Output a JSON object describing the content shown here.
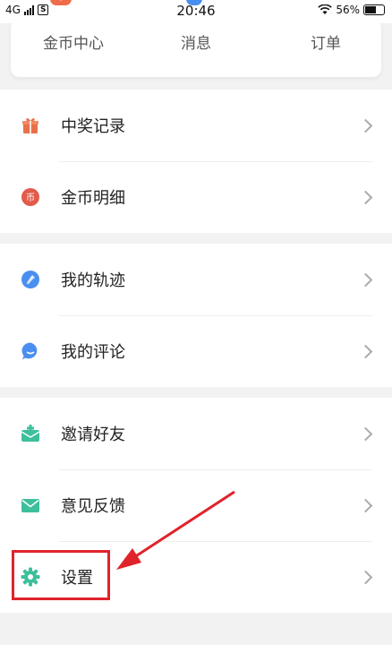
{
  "status_bar": {
    "network": "4G",
    "sim": "S",
    "time": "20:46",
    "battery": "56%"
  },
  "card": {
    "tabs": [
      "金币中心",
      "消息",
      "订单"
    ]
  },
  "sections": [
    {
      "items": [
        {
          "label": "中奖记录",
          "icon": "gift-icon"
        },
        {
          "label": "金币明细",
          "icon": "coin-icon"
        }
      ]
    },
    {
      "items": [
        {
          "label": "我的轨迹",
          "icon": "compass-icon"
        },
        {
          "label": "我的评论",
          "icon": "comment-icon"
        }
      ]
    },
    {
      "items": [
        {
          "label": "邀请好友",
          "icon": "invite-mail-icon"
        },
        {
          "label": "意见反馈",
          "icon": "envelope-icon"
        },
        {
          "label": "设置",
          "icon": "gear-icon"
        }
      ]
    }
  ],
  "colors": {
    "highlight": "#e0232b",
    "gift": "#e8704a",
    "coin": "#e25b4a",
    "blue": "#4a8ff0",
    "green": "#3dbf9c"
  }
}
